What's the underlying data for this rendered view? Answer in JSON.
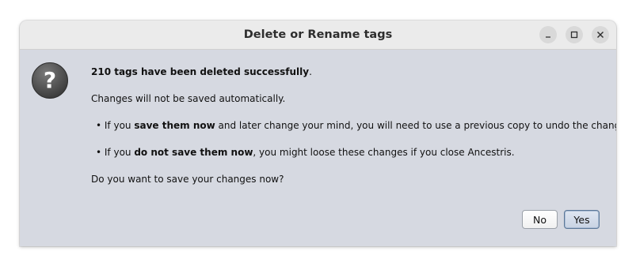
{
  "window": {
    "title": "Delete or Rename tags"
  },
  "icons": {
    "dialog_icon": "question-mark-icon",
    "minimize": "minimize-icon",
    "maximize": "maximize-icon",
    "close": "close-icon"
  },
  "message": {
    "headline_bold": "210 tags have been deleted successfully",
    "headline_tail": ".",
    "line2": "Changes will not be saved automatically.",
    "bullet1_prefix": "• If you ",
    "bullet1_bold": "save them now",
    "bullet1_suffix": " and later change your mind, you will need to use a previous copy to undo the changes.",
    "bullet2_prefix": "• If you ",
    "bullet2_bold": "do not save them now",
    "bullet2_suffix": ", you might loose these changes if you close Ancestris.",
    "question": "Do you want to save your changes now?"
  },
  "buttons": {
    "no_label": "No",
    "yes_label": "Yes"
  },
  "colors": {
    "dialog_background": "#d6d9e1",
    "titlebar": "#ebebeb",
    "default_button": "#c9d3e3"
  }
}
